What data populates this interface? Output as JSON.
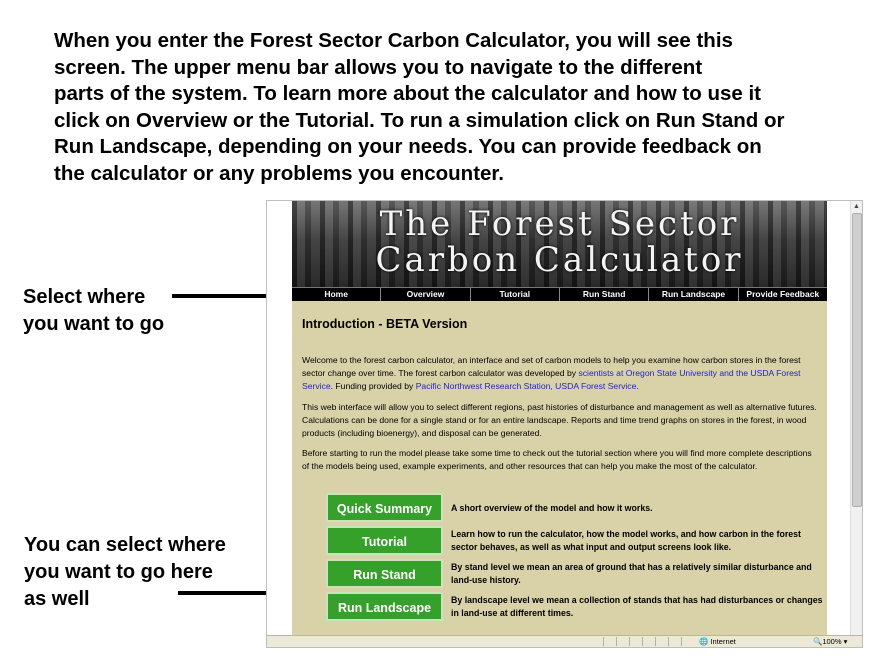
{
  "slide": {
    "intro_lines": [
      "When you enter the Forest Sector Carbon Calculator, you will see this",
      "screen.  The upper menu bar allows you to navigate to the different",
      "parts of the system. To learn more about the calculator and how to use it",
      "click on Overview or the Tutorial. To run a simulation click on Run Stand or",
      "Run Landscape, depending on your needs. You can provide feedback on",
      "the calculator or any problems you encounter."
    ],
    "callout_nav_lines": [
      "Select where",
      "you want to go"
    ],
    "callout_buttons_lines": [
      "You can select where",
      "you want to go here",
      "as well"
    ]
  },
  "site": {
    "banner_line1": "The Forest Sector",
    "banner_line2": "Carbon Calculator",
    "nav": [
      "Home",
      "Overview",
      "Tutorial",
      "Run Stand",
      "Run Landscape",
      "Provide Feedback"
    ],
    "heading": "Introduction - BETA Version",
    "p1_a": "Welcome to the forest carbon calculator, an interface and set of carbon models to help you examine how carbon stores in the forest sector change over time. The forest carbon calculator was developed by ",
    "p1_link1": "scientists at Oregon State University and the USDA Forest Service",
    "p1_b": ". Funding provided by ",
    "p1_link2": "Pacific Northwest Research Station, USDA Forest Service",
    "p1_c": ".",
    "p2": "This web interface will allow you to select different regions, past histories of disturbance and management as well as alternative futures. Calculations can be done for a single stand or for an entire landscape. Reports and time trend graphs on stores in the forest, in wood products (including bioenergy), and disposal can be generated.",
    "p3": "Before starting to run the model please take some time to check out the tutorial section where you will find more complete descriptions of the models being used, example experiments, and other resources that can help you make the most of the calculator.",
    "quick": [
      {
        "label": "Quick Summary",
        "desc": "A short overview of the model and how it works."
      },
      {
        "label": "Tutorial",
        "desc": "Learn how to run the calculator, how the model works, and how carbon in the forest sector behaves, as well as what input and output screens look like."
      },
      {
        "label": "Run Stand",
        "desc": "By stand level we mean an area of ground that has a relatively similar disturbance and land-use history."
      },
      {
        "label": "Run Landscape",
        "desc": "By landscape level we mean a collection of stands that has had disturbances or changes in land-use at different times."
      }
    ]
  },
  "browser": {
    "zone": "Internet",
    "zoom": "100%"
  },
  "colors": {
    "content_bg": "#d9d2a9",
    "button_green": "#35a12a",
    "link_blue": "#2222c8"
  }
}
